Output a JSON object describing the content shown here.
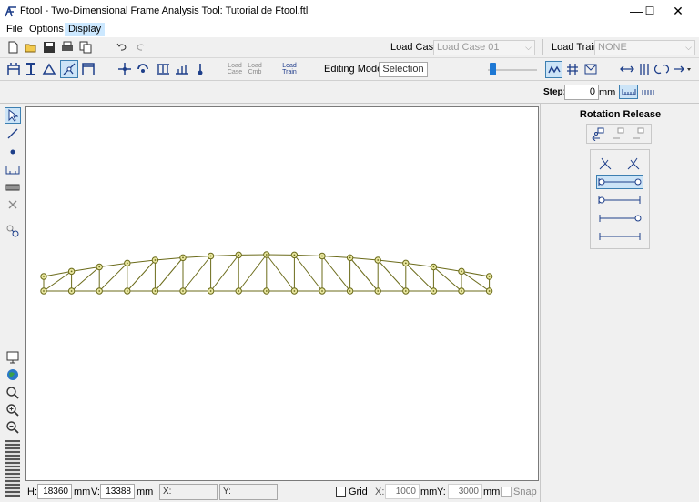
{
  "window": {
    "title": "Ftool - Two-Dimensional Frame Analysis Tool: Tutorial de Ftool.ftl",
    "minimize": "—",
    "maximize": "☐",
    "close": "✕"
  },
  "menu": {
    "items": [
      {
        "label": "File"
      },
      {
        "label": "Options"
      },
      {
        "label": "Display",
        "active": true
      }
    ]
  },
  "toolbar1": {
    "load_case_label": "Load Case:",
    "load_case_value": "Load Case 01",
    "load_train_label": "Load Train:",
    "load_train_value": "NONE"
  },
  "toolbar2": {
    "load_case_btn": [
      "Load",
      "Case"
    ],
    "load_comb_btn": [
      "Load",
      "Cmb"
    ],
    "load_train_btn": [
      "Load",
      "Train"
    ],
    "editing_mode_label": "Editing Mode:",
    "editing_mode_value": "Selection"
  },
  "toolbar3": {
    "step_label": "Step:",
    "step_value": "0",
    "step_unit": "mm"
  },
  "right_panel": {
    "title": "Rotation Release"
  },
  "status": {
    "h_label": "H:",
    "h_value": "18360",
    "h_unit": "mm",
    "v_label": "V:",
    "v_value": "13388",
    "v_unit": "mm",
    "x_label": "X:",
    "y_label": "Y:",
    "grid_label": "Grid",
    "grid_x_label": "X:",
    "grid_x_value": "1000",
    "grid_x_unit": "mm",
    "grid_y_label": "Y:",
    "grid_y_value": "3000",
    "grid_y_unit": "mm",
    "snap_label": "Snap"
  },
  "colors": {
    "truss_line": "#6b6b1a",
    "node_fill": "#e8e6a0",
    "accent": "#1e5fb4"
  }
}
